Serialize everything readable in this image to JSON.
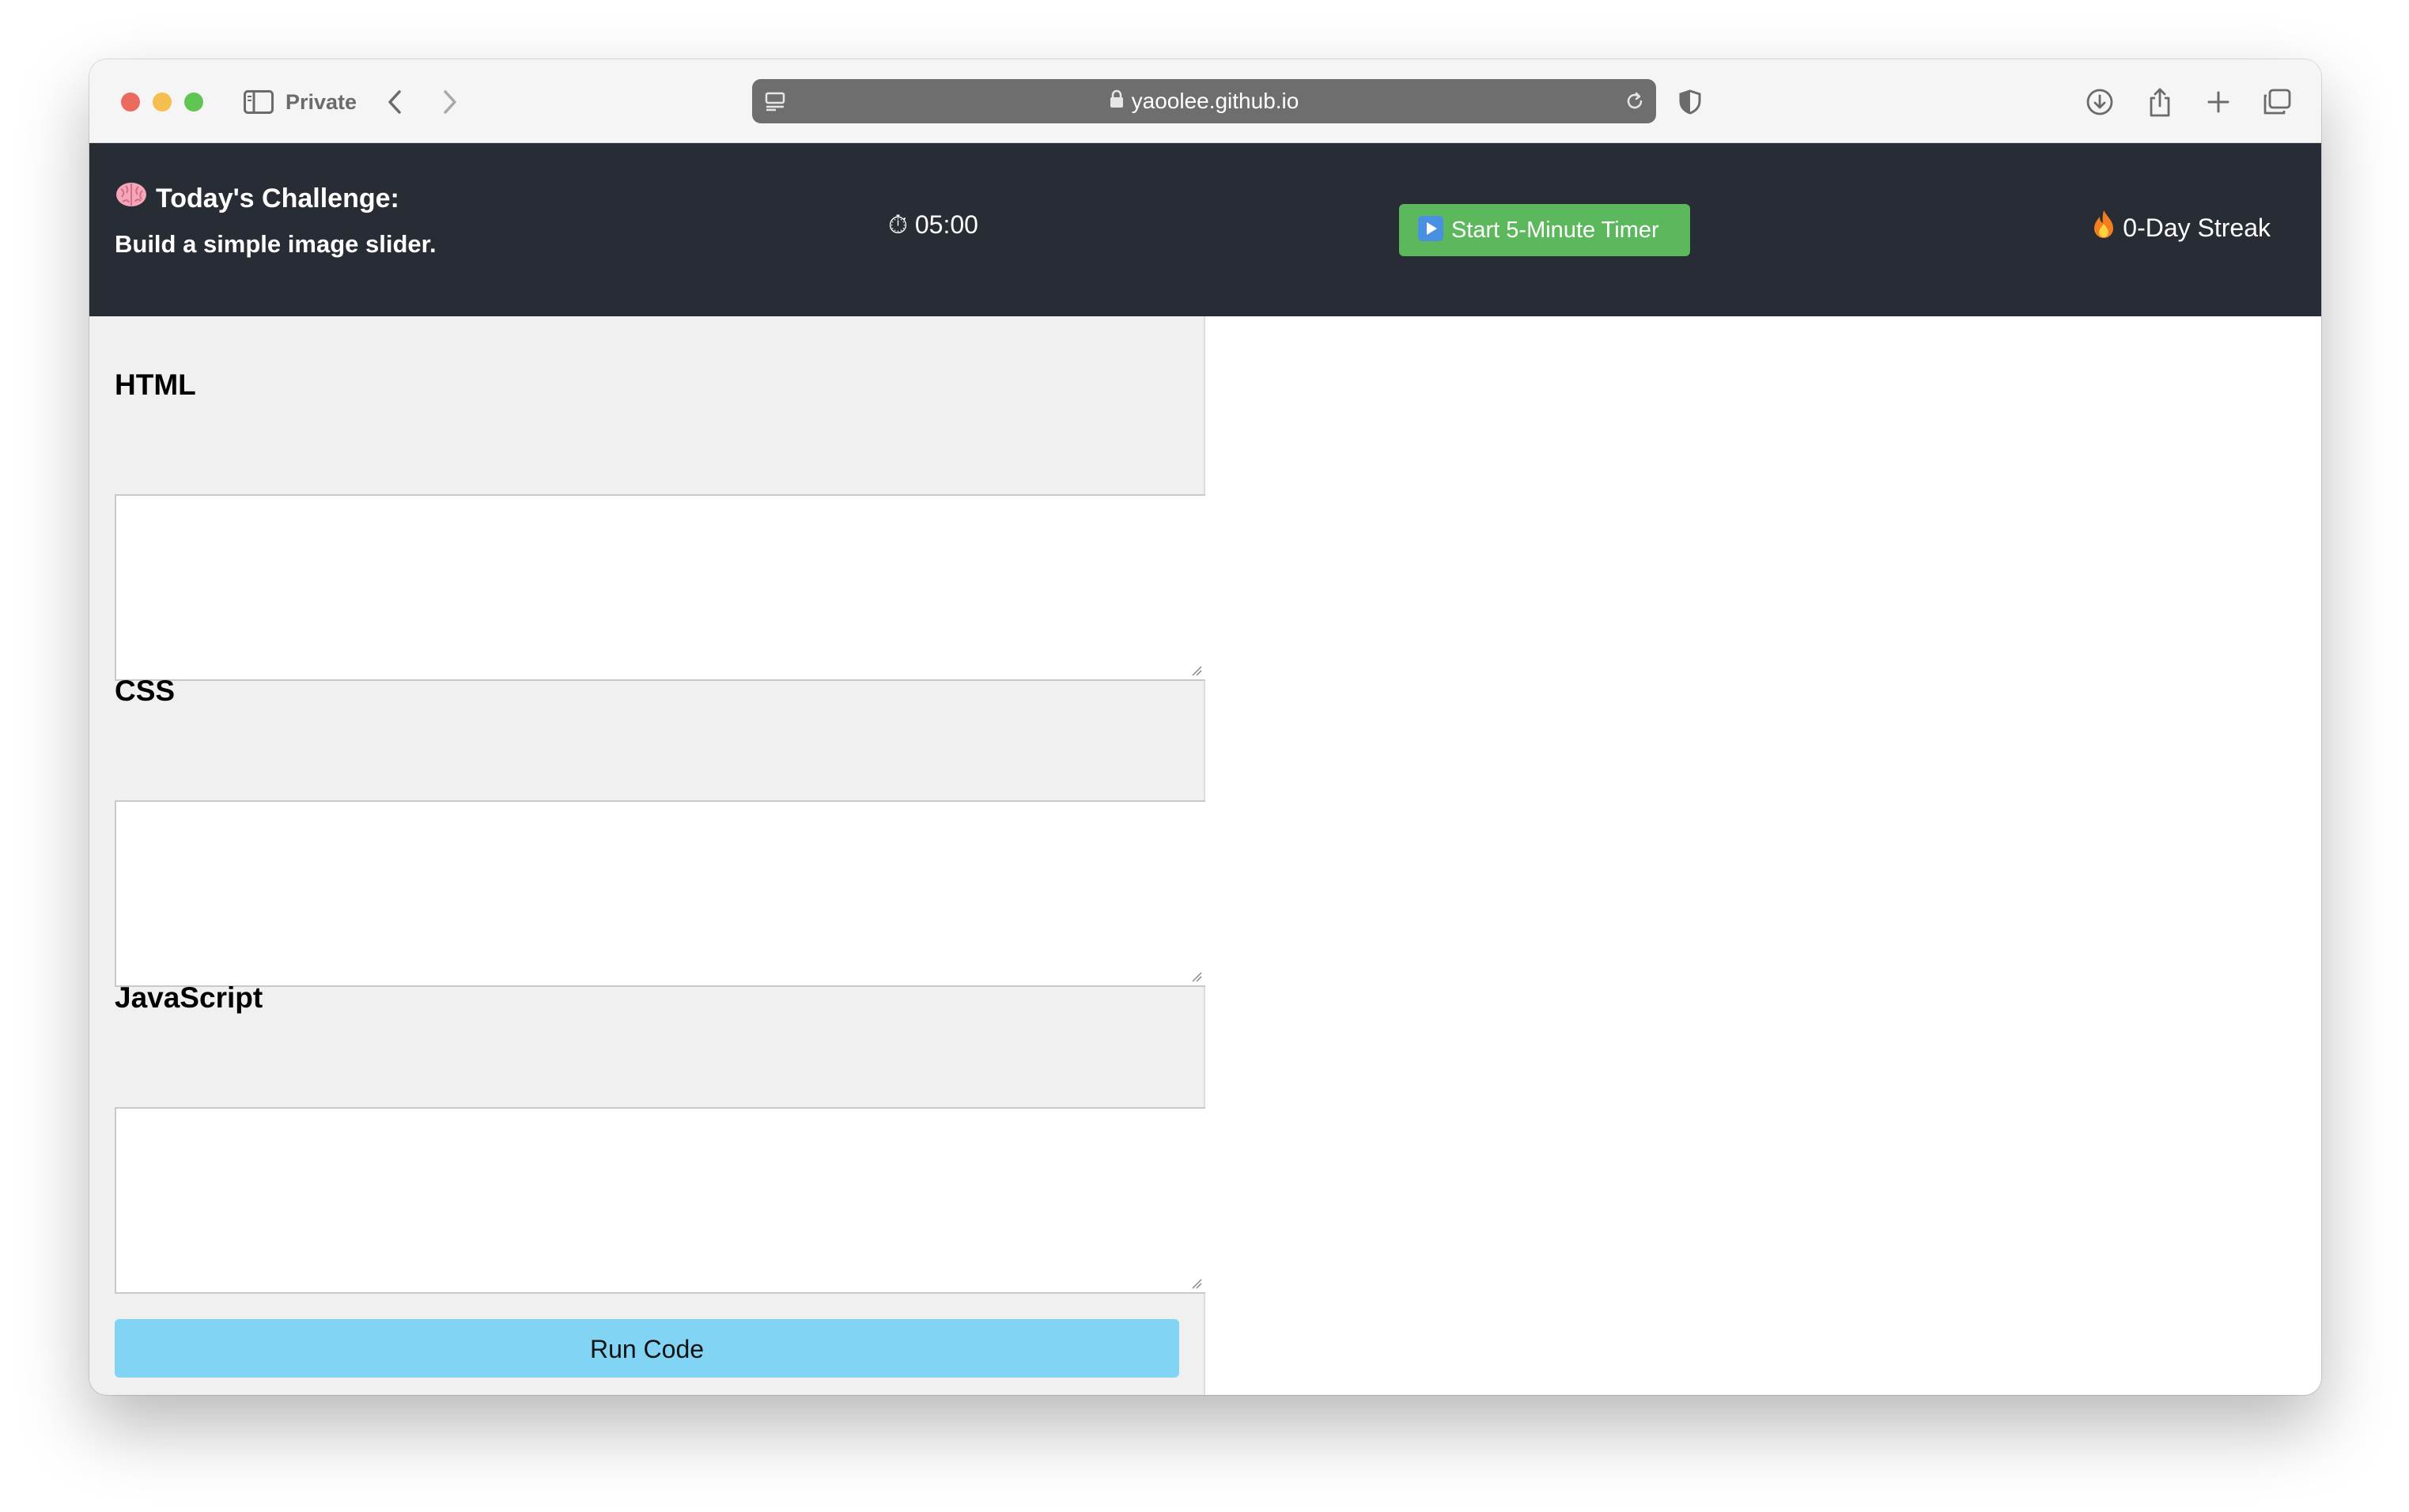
{
  "browser": {
    "private_label": "Private",
    "url": "yaoolee.github.io"
  },
  "header": {
    "challenge_title": "Today's Challenge:",
    "challenge_text": "Build a simple image slider.",
    "timer": "⏱ 05:00",
    "timer_button_label": "Start 5-Minute Timer",
    "streak": "0-Day Streak"
  },
  "editor": {
    "html_label": "HTML",
    "html_value": "",
    "css_label": "CSS",
    "css_value": "",
    "js_label": "JavaScript",
    "js_value": "",
    "run_label": "Run Code"
  },
  "colors": {
    "header_bg": "#282c34",
    "timer_button": "#5cb85c",
    "run_button": "#81d4f4",
    "editor_bg": "#f0f0f0"
  }
}
